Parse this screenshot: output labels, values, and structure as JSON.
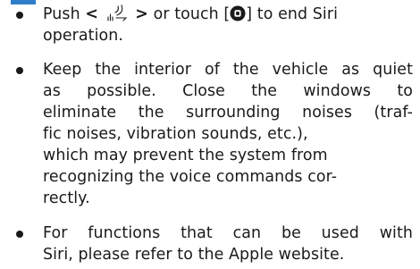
{
  "bullets": [
    {
      "line1": {
        "push": "Push",
        "left_chevron": "<",
        "right_chevron": ">",
        "middle": "or touch [",
        "end": "] to end Siri"
      },
      "line2": "operation."
    },
    {
      "lines": [
        "Keep the interior of the vehicle as quiet",
        "as possible. Close the windows to",
        "eliminate the surrounding noises (traf-",
        "fic noises, vibration sounds, etc.),",
        "which may prevent the system from",
        "recognizing the voice commands cor-",
        "rectly."
      ]
    },
    {
      "lines": [
        "For functions that can be used with",
        "Siri, please refer to the Apple website."
      ]
    }
  ],
  "icons": {
    "voice_control": "steering-switch-voice-icon",
    "end_session": "end-session-button-icon"
  },
  "colors": {
    "text": "#1a1a1a",
    "accent": "#2f7ec8"
  }
}
